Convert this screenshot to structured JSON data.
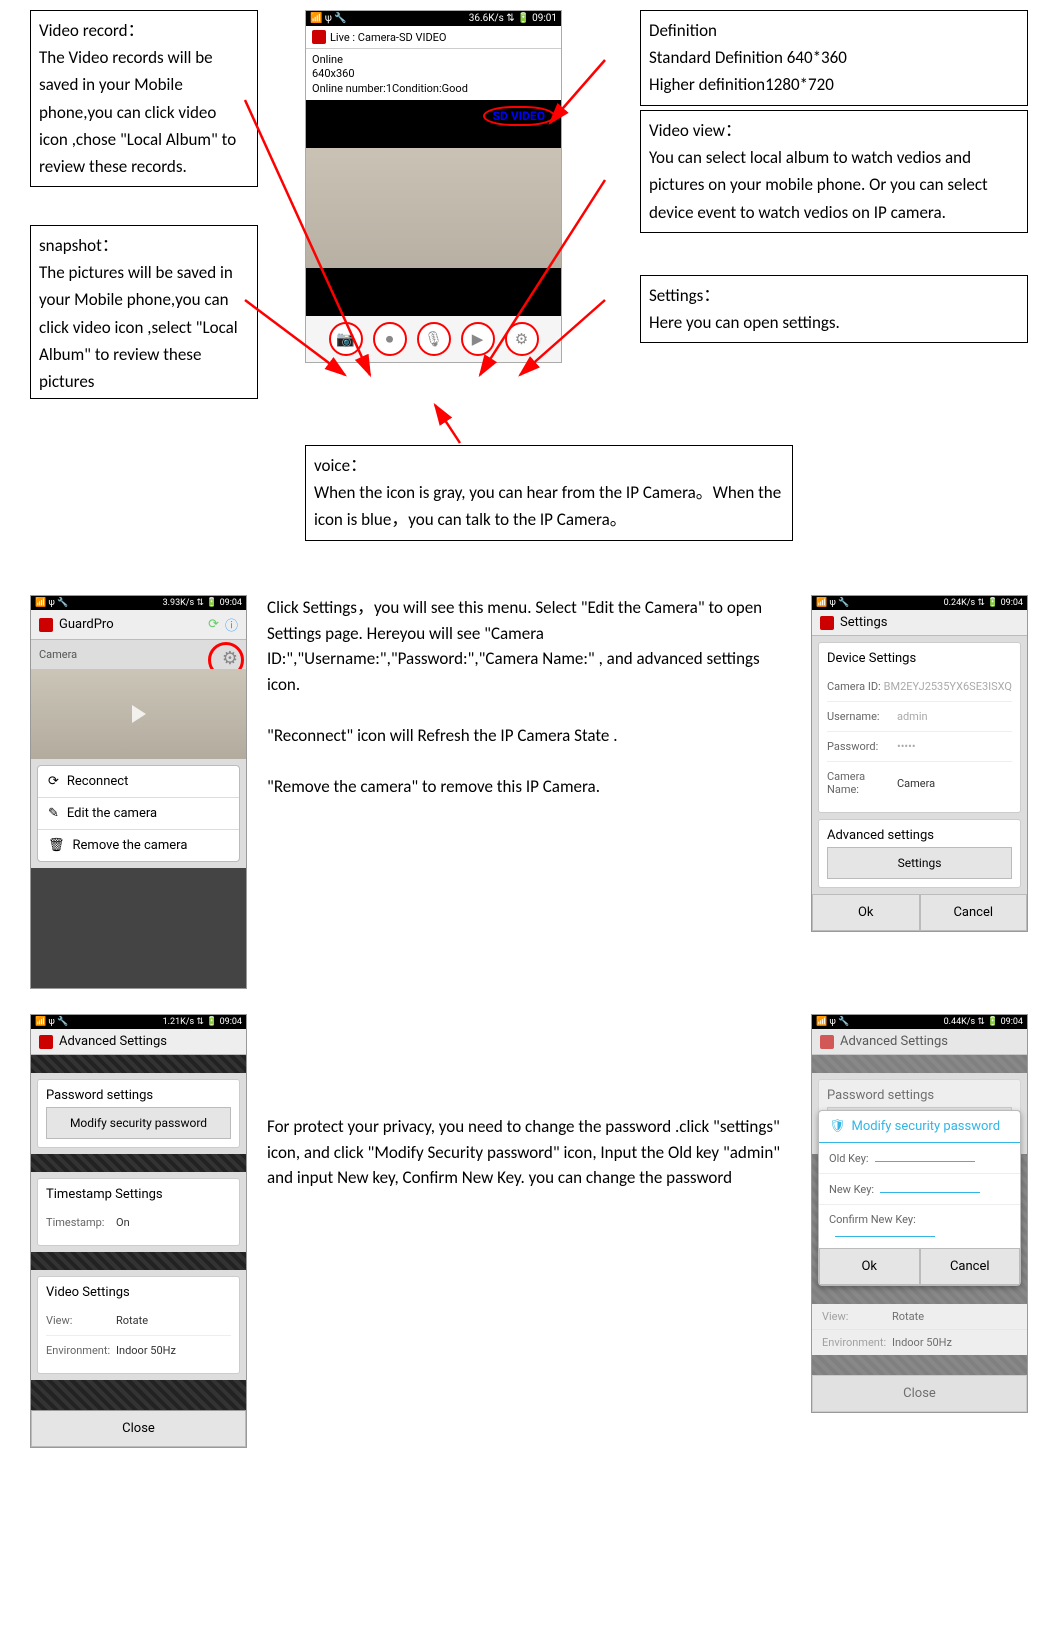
{
  "callouts": {
    "video_record": "Video record：\nThe Video records will be saved in your Mobile phone,you can click video icon ,chose \"Local Album\" to review these records.",
    "snapshot": "snapshot：\nThe pictures will be saved in your Mobile phone,you can click video icon ,select \"Local Album\" to review these pictures",
    "definition": "Definition\nStandard Definition 640*360\nHigher definition1280*720",
    "video_view": "Video view：\nYou can select local album to watch vedios and pictures on your mobile phone. Or you can select device event to watch vedios on IP camera.",
    "settings": "Settings：\nHere you can open settings.",
    "voice": "voice：\nWhen the icon is gray, you can hear from the IP Camera。When the icon is blue，you can talk to the IP Camera。"
  },
  "live_screen": {
    "status": {
      "left": "📶 ψ 🔧",
      "right": "36.6K/s ⇅ 🔋 09:01"
    },
    "title": "Live : Camera-SD VIDEO",
    "info1": "Online",
    "info2": "640x360",
    "info3": "Online number:1Condition:Good",
    "sd_label": "SD VIDEO",
    "icons": [
      "📷",
      "⏺",
      "🎙",
      "▶",
      "⚙"
    ]
  },
  "mid_text_1": "Click Settings，you will see this menu. Select \"Edit the Camera\" to open Settings page. Hereyou will see \"Camera ID:\",\"Username:\",\"Password:\",\"Camera Name:\" , and advanced settings icon.\n\n\"Reconnect\" icon will Refresh the IP Camera State .\n\n\"Remove the camera\" to remove this IP Camera.",
  "menu_phone": {
    "status": {
      "left": "📶 ψ 🔧",
      "right": "3.93K/s ⇅ 🔋 09:04"
    },
    "app_title": "GuardPro",
    "header": "Camera",
    "items": [
      "Reconnect",
      "Edit the camera",
      "Remove the camera"
    ]
  },
  "settings_phone": {
    "status": {
      "left": "📶 ψ 🔧",
      "right": "0.24K/s ⇅ 🔋 09:04"
    },
    "app_title": "Settings",
    "section": "Device Settings",
    "fields": {
      "camera_id": {
        "label": "Camera ID:",
        "value": "BM2EYJ2535YX6SE3ISXQ"
      },
      "username": {
        "label": "Username:",
        "value": "admin"
      },
      "password": {
        "label": "Password:",
        "value": "•••••"
      },
      "camera_name": {
        "label": "Camera Name:",
        "value": "Camera"
      }
    },
    "adv_title": "Advanced settings",
    "adv_btn": "Settings",
    "ok": "Ok",
    "cancel": "Cancel"
  },
  "mid_text_2": "For protect your privacy, you need to change the password .click \"settings\" icon, and click \"Modify Security password\" icon, Input the Old key \"admin\" and input New key, Confirm New Key. you can change the password",
  "adv_phone": {
    "status": {
      "left": "📶 ψ 🔧",
      "right": "1.21K/s ⇅ 🔋 09:04"
    },
    "app_title": "Advanced Settings",
    "pwd_title": "Password settings",
    "pwd_btn": "Modify security password",
    "ts_title": "Timestamp Settings",
    "ts_label": "Timestamp:",
    "ts_value": "On",
    "vid_title": "Video Settings",
    "view_label": "View:",
    "view_value": "Rotate",
    "env_label": "Environment:",
    "env_value": "Indoor 50Hz",
    "close": "Close"
  },
  "pwd_dialog_phone": {
    "status": {
      "left": "📶 ψ 🔧",
      "right": "0.44K/s ⇅ 🔋 09:04"
    },
    "app_title": "Advanced Settings",
    "pwd_title": "Password settings",
    "pwd_btn": "Modify security password",
    "dialog_title": "Modify security password",
    "old": "Old Key:",
    "new": "New Key:",
    "confirm": "Confirm New Key:",
    "ok": "Ok",
    "cancel": "Cancel",
    "view_label": "View:",
    "view_value": "Rotate",
    "env_label": "Environment:",
    "env_value": "Indoor 50Hz",
    "close": "Close"
  }
}
